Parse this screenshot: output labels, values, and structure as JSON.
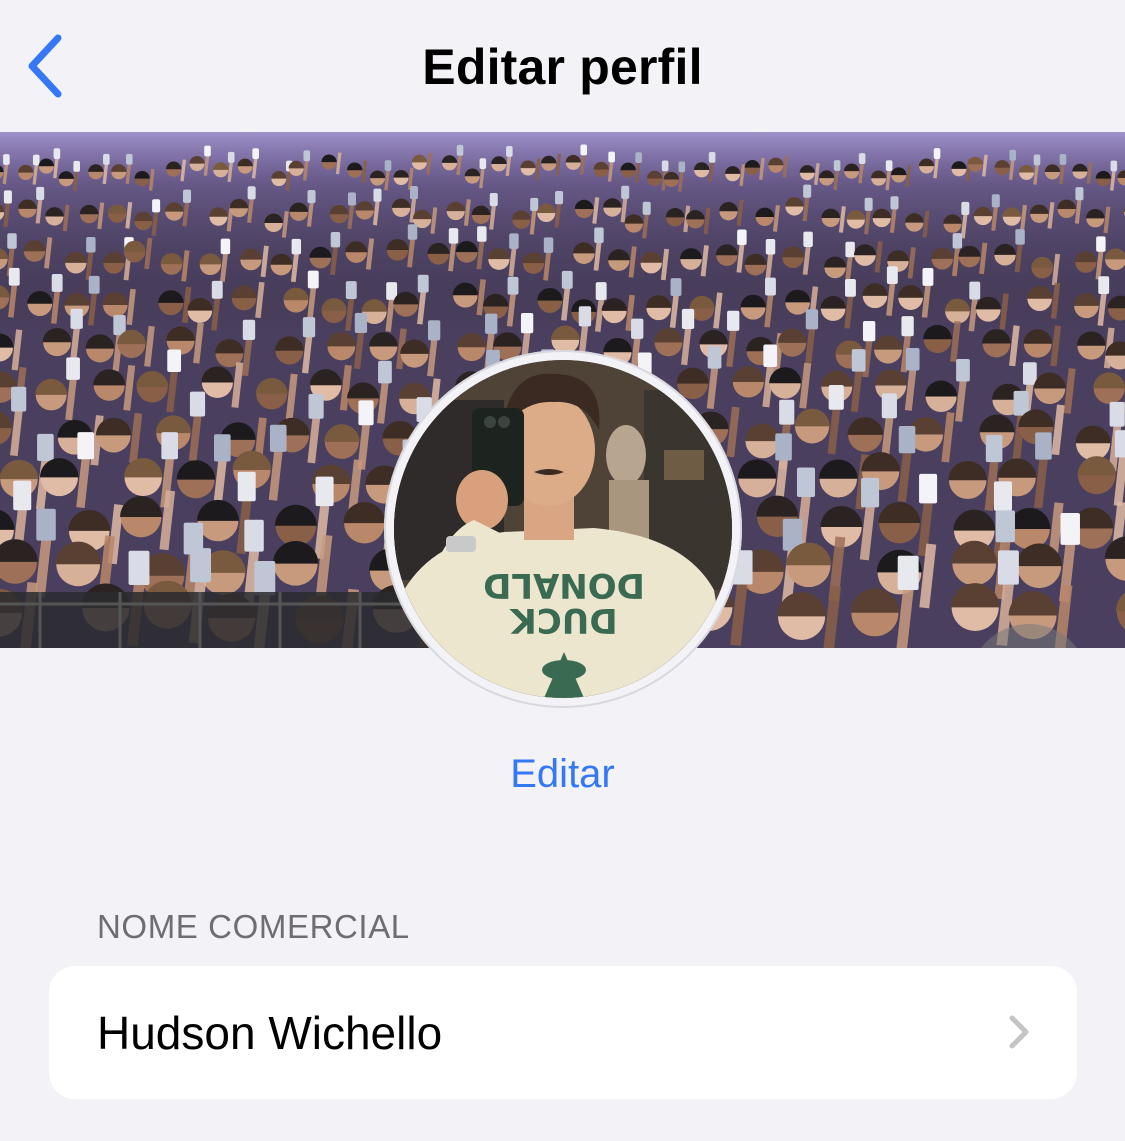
{
  "nav": {
    "title": "Editar perfil",
    "back_icon": "chevron-left-icon"
  },
  "cover": {
    "description_icon": "cover-photo",
    "camera_icon": "camera-icon"
  },
  "avatar": {
    "icon": "profile-photo",
    "shirt_text_line1": "DONALD",
    "shirt_text_line2": "DUCK"
  },
  "edit_label": "Editar",
  "section": {
    "header": "NOME COMERCIAL",
    "value": "Hudson Wichello",
    "chevron_icon": "chevron-right-icon"
  },
  "colors": {
    "accent": "#3478f6",
    "background": "#f2f2f7",
    "card": "#ffffff",
    "secondary_text": "#6d6d72"
  }
}
